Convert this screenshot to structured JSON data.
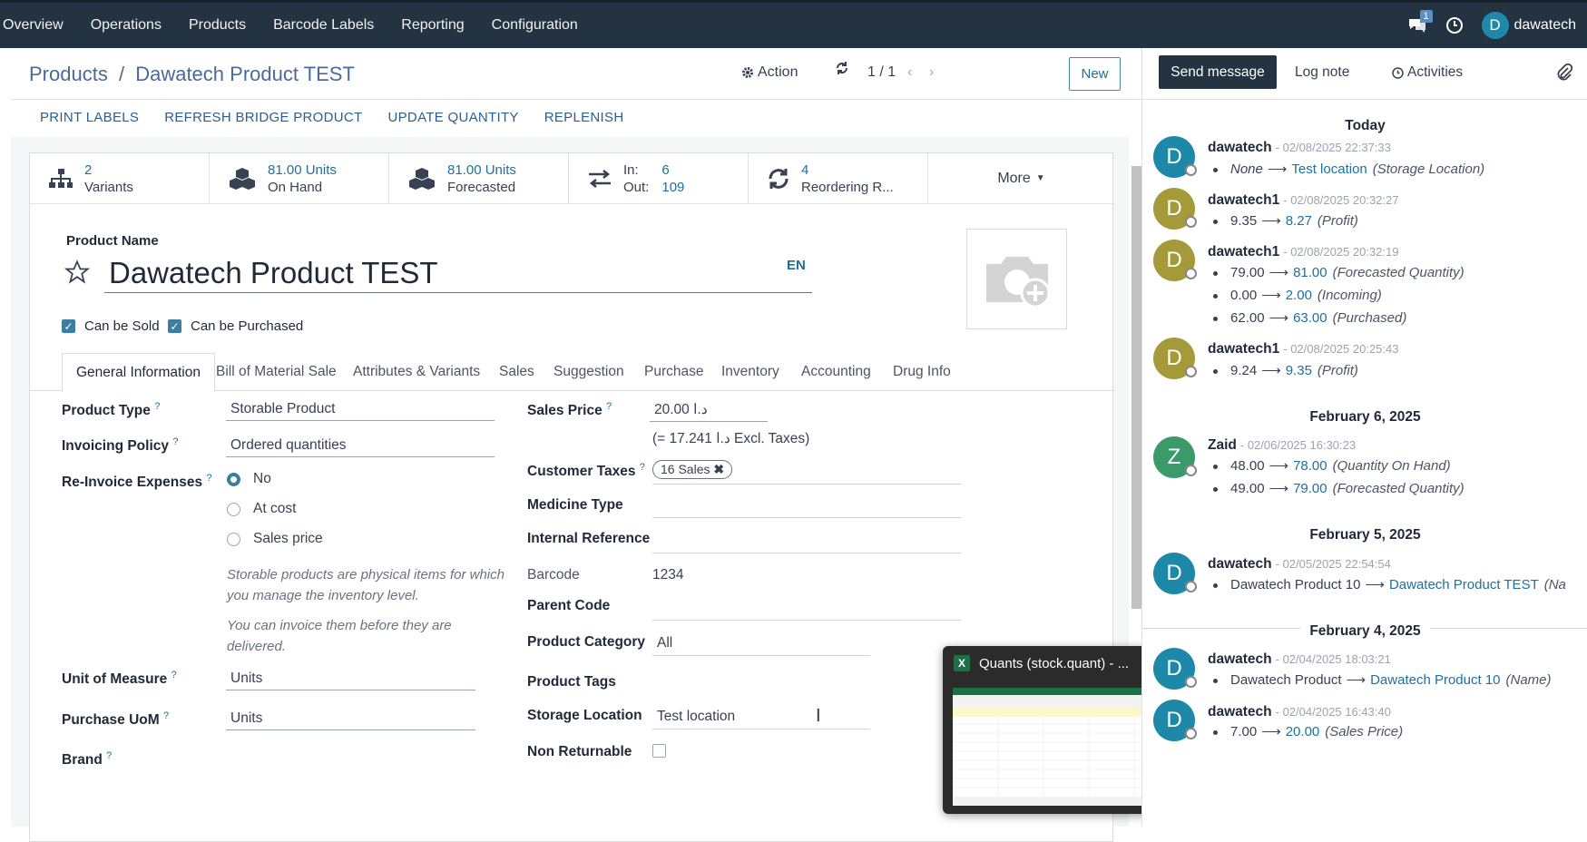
{
  "topbar": {
    "menu": [
      "Overview",
      "Operations",
      "Products",
      "Barcode Labels",
      "Reporting",
      "Configuration"
    ],
    "chat_count": "1",
    "user_initial": "D",
    "user_name": "dawatech"
  },
  "header": {
    "breadcrumb_parent": "Products",
    "breadcrumb_sep": "/",
    "breadcrumb_current": "Dawatech Product TEST",
    "action_label": "Action",
    "pager": "1 / 1",
    "new_label": "New"
  },
  "action_buttons": [
    "PRINT LABELS",
    "REFRESH BRIDGE PRODUCT",
    "UPDATE QUANTITY",
    "REPLENISH"
  ],
  "stats": [
    {
      "icon": "sitemap-icon",
      "value": "2",
      "label": "Variants"
    },
    {
      "icon": "cubes-icon",
      "value": "81.00 Units",
      "label": "On Hand"
    },
    {
      "icon": "cubes-icon",
      "value": "81.00 Units",
      "label": "Forecasted"
    },
    {
      "icon": "exchange-icon",
      "in_label": "In:",
      "in_value": "6",
      "out_label": "Out:",
      "out_value": "109"
    },
    {
      "icon": "refresh-icon",
      "value": "4",
      "label": "Reordering R..."
    }
  ],
  "more_label": "More",
  "product": {
    "name_label": "Product Name",
    "name": "Dawatech Product TEST",
    "lang": "EN",
    "can_be_sold": "Can be Sold",
    "can_be_purchased": "Can be Purchased"
  },
  "tabs": [
    "General Information",
    "Bill of Material Sale",
    "Attributes & Variants",
    "Sales",
    "Suggestion",
    "Purchase",
    "Inventory",
    "Accounting",
    "Drug Info"
  ],
  "left_fields": {
    "product_type_label": "Product Type",
    "product_type": "Storable Product",
    "invoicing_policy_label": "Invoicing Policy",
    "invoicing_policy": "Ordered quantities",
    "reinvoice_label": "Re-Invoice Expenses",
    "reinvoice_options": [
      "No",
      "At cost",
      "Sales price"
    ],
    "help1": "Storable products are physical items for which you manage the inventory level.",
    "help2": "You can invoice them before they are delivered.",
    "uom_label": "Unit of Measure",
    "uom": "Units",
    "purchase_uom_label": "Purchase UoM",
    "purchase_uom": "Units",
    "brand_label": "Brand",
    "help_mark": "?"
  },
  "right_fields": {
    "sales_price_label": "Sales Price",
    "sales_price": "د.ا 20.00",
    "excl_taxes": "(= 17.241  د.ا Excl. Taxes)",
    "customer_taxes_label": "Customer Taxes",
    "customer_taxes_tag": "16 Sales",
    "medicine_type_label": "Medicine Type",
    "internal_ref_label": "Internal Reference",
    "barcode_label": "Barcode",
    "barcode": "1234",
    "parent_code_label": "Parent Code",
    "category_label": "Product Category",
    "category": "All",
    "tags_label": "Product Tags",
    "storage_label": "Storage Location",
    "storage": "Test location",
    "non_returnable_label": "Non Returnable"
  },
  "popup": {
    "title": "Quants (stock.quant) - ...",
    "app_letter": "X"
  },
  "chatter": {
    "send_message": "Send message",
    "log_note": "Log note",
    "activities": "Activities",
    "messages": [
      {
        "day": "Today"
      },
      {
        "initial": "D",
        "color": "#1e88a8",
        "author": "dawatech",
        "ts": "- 02/08/2025 22:37:33",
        "tracks": [
          {
            "old": "None",
            "new": "Test location",
            "field": "(Storage Location)",
            "old_italic": true
          }
        ]
      },
      {
        "initial": "D",
        "color": "#a59a3a",
        "author": "dawatech1",
        "ts": "- 02/08/2025 20:32:27",
        "tracks": [
          {
            "old": "9.35",
            "new": "8.27",
            "field": "(Profit)"
          }
        ]
      },
      {
        "initial": "D",
        "color": "#a59a3a",
        "author": "dawatech1",
        "ts": "- 02/08/2025 20:32:19",
        "tracks": [
          {
            "old": "79.00",
            "new": "81.00",
            "field": "(Forecasted Quantity)"
          },
          {
            "old": "0.00",
            "new": "2.00",
            "field": "(Incoming)"
          },
          {
            "old": "62.00",
            "new": "63.00",
            "field": "(Purchased)"
          }
        ]
      },
      {
        "initial": "D",
        "color": "#a59a3a",
        "author": "dawatech1",
        "ts": "- 02/08/2025 20:25:43",
        "tracks": [
          {
            "old": "9.24",
            "new": "9.35",
            "field": "(Profit)"
          }
        ]
      },
      {
        "day": "February 6, 2025"
      },
      {
        "initial": "Z",
        "color": "#3a9a6a",
        "author": "Zaid",
        "ts": "- 02/06/2025 16:30:23",
        "tracks": [
          {
            "old": "48.00",
            "new": "78.00",
            "field": "(Quantity On Hand)"
          },
          {
            "old": "49.00",
            "new": "79.00",
            "field": "(Forecasted Quantity)"
          }
        ]
      },
      {
        "day": "February 5, 2025"
      },
      {
        "initial": "D",
        "color": "#1e88a8",
        "author": "dawatech",
        "ts": "- 02/05/2025 22:54:54",
        "tracks": [
          {
            "old": "Dawatech Product 10",
            "new": "Dawatech Product TEST",
            "field": "(Na"
          }
        ]
      },
      {
        "day": "February 4, 2025"
      },
      {
        "initial": "D",
        "color": "#1e88a8",
        "author": "dawatech",
        "ts": "- 02/04/2025 18:03:21",
        "tracks": [
          {
            "old": "Dawatech Product",
            "new": "Dawatech Product 10",
            "field": "(Name)"
          }
        ]
      },
      {
        "initial": "D",
        "color": "#1e88a8",
        "author": "dawatech",
        "ts": "- 02/04/2025 16:43:40",
        "tracks": [
          {
            "old": "7.00",
            "new": "20.00",
            "field": "(Sales Price)"
          }
        ]
      }
    ]
  }
}
